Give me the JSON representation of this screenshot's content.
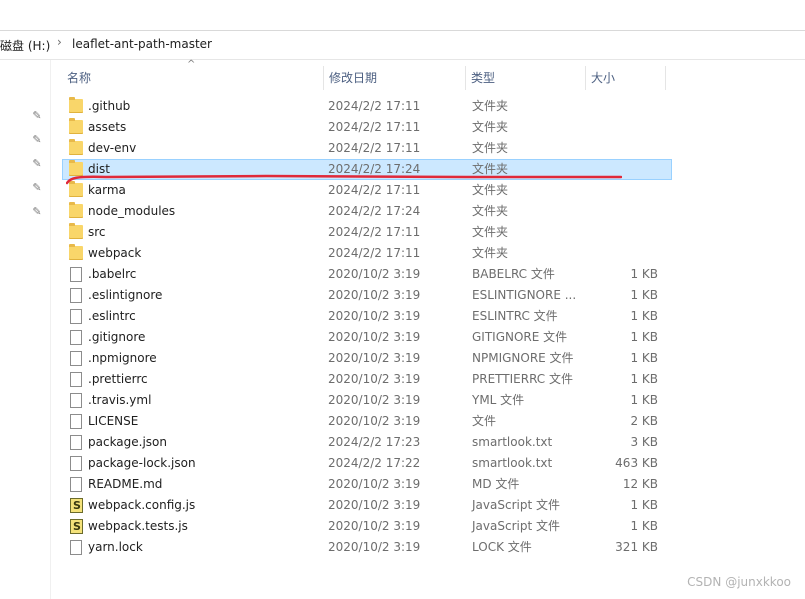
{
  "address_bar": {
    "drive_label": "磁盘 (H:)",
    "separator": "›",
    "current_folder": "leaflet-ant-path-master"
  },
  "columns": {
    "name": "名称",
    "date": "修改日期",
    "type": "类型",
    "size": "大小"
  },
  "files": [
    {
      "name": ".github",
      "date": "2024/2/2 17:11",
      "type": "文件夹",
      "size": "",
      "icon": "folder-icon"
    },
    {
      "name": "assets",
      "date": "2024/2/2 17:11",
      "type": "文件夹",
      "size": "",
      "icon": "folder-icon"
    },
    {
      "name": "dev-env",
      "date": "2024/2/2 17:11",
      "type": "文件夹",
      "size": "",
      "icon": "folder-icon"
    },
    {
      "name": "dist",
      "date": "2024/2/2 17:24",
      "type": "文件夹",
      "size": "",
      "icon": "folder-icon",
      "selected": true
    },
    {
      "name": "karma",
      "date": "2024/2/2 17:11",
      "type": "文件夹",
      "size": "",
      "icon": "folder-icon"
    },
    {
      "name": "node_modules",
      "date": "2024/2/2 17:24",
      "type": "文件夹",
      "size": "",
      "icon": "folder-icon"
    },
    {
      "name": "src",
      "date": "2024/2/2 17:11",
      "type": "文件夹",
      "size": "",
      "icon": "folder-icon"
    },
    {
      "name": "webpack",
      "date": "2024/2/2 17:11",
      "type": "文件夹",
      "size": "",
      "icon": "folder-icon"
    },
    {
      "name": ".babelrc",
      "date": "2020/10/2 3:19",
      "type": "BABELRC 文件",
      "size": "1 KB",
      "icon": "file-icon"
    },
    {
      "name": ".eslintignore",
      "date": "2020/10/2 3:19",
      "type": "ESLINTIGNORE ...",
      "size": "1 KB",
      "icon": "file-icon"
    },
    {
      "name": ".eslintrc",
      "date": "2020/10/2 3:19",
      "type": "ESLINTRC 文件",
      "size": "1 KB",
      "icon": "file-icon"
    },
    {
      "name": ".gitignore",
      "date": "2020/10/2 3:19",
      "type": "GITIGNORE 文件",
      "size": "1 KB",
      "icon": "file-icon"
    },
    {
      "name": ".npmignore",
      "date": "2020/10/2 3:19",
      "type": "NPMIGNORE 文件",
      "size": "1 KB",
      "icon": "file-icon"
    },
    {
      "name": ".prettierrc",
      "date": "2020/10/2 3:19",
      "type": "PRETTIERRC 文件",
      "size": "1 KB",
      "icon": "file-icon"
    },
    {
      "name": ".travis.yml",
      "date": "2020/10/2 3:19",
      "type": "YML 文件",
      "size": "1 KB",
      "icon": "file-icon"
    },
    {
      "name": "LICENSE",
      "date": "2020/10/2 3:19",
      "type": "文件",
      "size": "2 KB",
      "icon": "file-icon"
    },
    {
      "name": "package.json",
      "date": "2024/2/2 17:23",
      "type": "smartlook.txt",
      "size": "3 KB",
      "icon": "file-icon"
    },
    {
      "name": "package-lock.json",
      "date": "2024/2/2 17:22",
      "type": "smartlook.txt",
      "size": "463 KB",
      "icon": "file-icon"
    },
    {
      "name": "README.md",
      "date": "2020/10/2 3:19",
      "type": "MD 文件",
      "size": "12 KB",
      "icon": "file-icon"
    },
    {
      "name": "webpack.config.js",
      "date": "2020/10/2 3:19",
      "type": "JavaScript 文件",
      "size": "1 KB",
      "icon": "js-icon"
    },
    {
      "name": "webpack.tests.js",
      "date": "2020/10/2 3:19",
      "type": "JavaScript 文件",
      "size": "1 KB",
      "icon": "js-icon"
    },
    {
      "name": "yarn.lock",
      "date": "2020/10/2 3:19",
      "type": "LOCK 文件",
      "size": "321 KB",
      "icon": "file-icon"
    }
  ],
  "watermark": "CSDN @junxkkoo",
  "colors": {
    "selection_bg": "#cce8ff",
    "selection_border": "#99d1ff",
    "annotation_red": "#e0293a",
    "header_text": "#4d6082"
  }
}
